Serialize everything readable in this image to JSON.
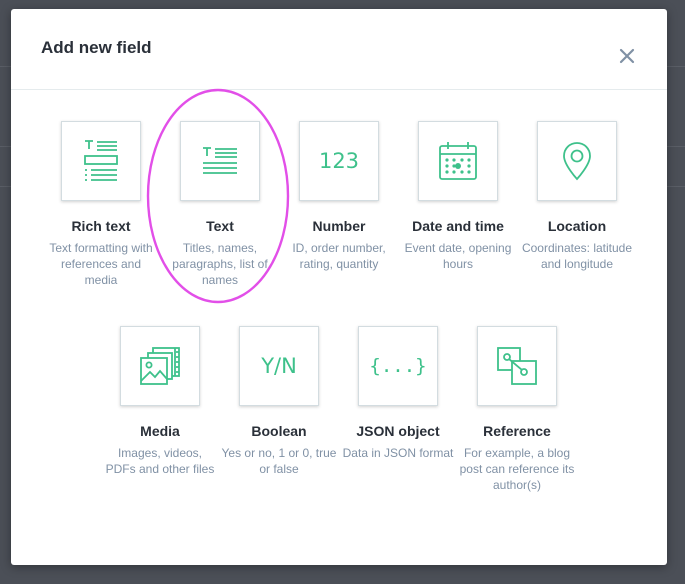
{
  "modal": {
    "title": "Add new field"
  },
  "colors": {
    "accent": "#3ec18b",
    "highlight": "#e24fe8",
    "title": "#2a3039",
    "description": "#8091a5"
  },
  "fields": [
    {
      "label": "Rich text",
      "description": "Text formatting with references and media",
      "icon": "rich-text-icon"
    },
    {
      "label": "Text",
      "description": "Titles, names, paragraphs, list of names",
      "icon": "text-icon"
    },
    {
      "label": "Number",
      "description": "ID, order number, rating, quantity",
      "icon": "number-icon",
      "icon_text": "123"
    },
    {
      "label": "Date and time",
      "description": "Event date, opening hours",
      "icon": "calendar-icon"
    },
    {
      "label": "Location",
      "description": "Coordinates: latitude and longitude",
      "icon": "location-pin-icon"
    },
    {
      "label": "Media",
      "description": "Images, videos, PDFs and other files",
      "icon": "media-icon"
    },
    {
      "label": "Boolean",
      "description": "Yes or no, 1 or 0, true or false",
      "icon": "boolean-icon",
      "icon_text": "Y/N"
    },
    {
      "label": "JSON object",
      "description": "Data in JSON format",
      "icon": "json-icon",
      "icon_text": "{...}"
    },
    {
      "label": "Reference",
      "description": "For example, a blog post can reference its author(s)",
      "icon": "reference-icon"
    }
  ]
}
